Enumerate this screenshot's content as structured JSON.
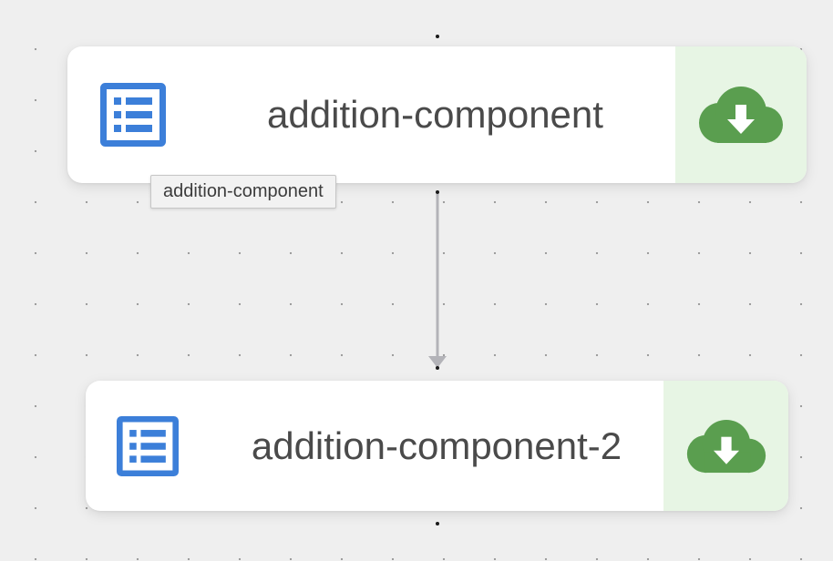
{
  "nodes": [
    {
      "label": "addition-component",
      "icon": "list-alt-icon",
      "action_icon": "cloud-download-icon"
    },
    {
      "label": "addition-component-2",
      "icon": "list-alt-icon",
      "action_icon": "cloud-download-icon"
    }
  ],
  "tooltip": {
    "text": "addition-component"
  },
  "colors": {
    "canvas_background": "#efefef",
    "grid_dot": "#9a9a9a",
    "node_background": "#ffffff",
    "icon_blue": "#3c7fd9",
    "action_background": "#e7f5e4",
    "download_green": "#5a9e4f",
    "edge": "#b3b3b8",
    "label_text": "#4a4a4a"
  }
}
